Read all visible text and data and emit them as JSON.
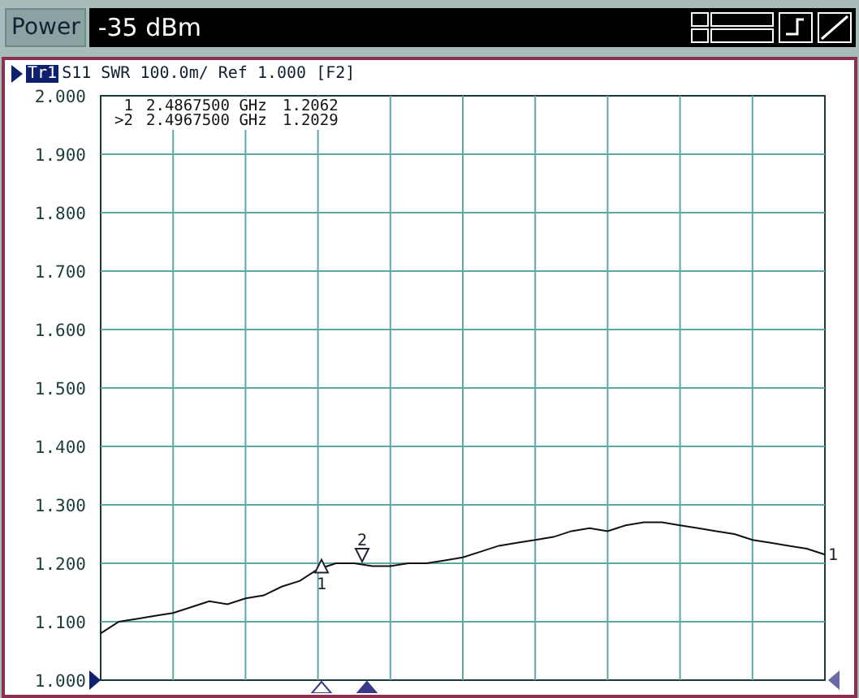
{
  "toolbar": {
    "label": "Power",
    "value": "-35 dBm"
  },
  "trace_header": {
    "trace": "Tr1",
    "text": "S11 SWR 100.0m/ Ref 1.000 [F2]"
  },
  "chart": {
    "chart_data": {
      "type": "line",
      "grid": true,
      "ylim": [
        1,
        2
      ],
      "yticks": [
        {
          "value": 2,
          "label": "2.000"
        },
        {
          "value": 1.9,
          "label": "1.900"
        },
        {
          "value": 1.8,
          "label": "1.800"
        },
        {
          "value": 1.7,
          "label": "1.700"
        },
        {
          "value": 1.6,
          "label": "1.600"
        },
        {
          "value": 1.5,
          "label": "1.500"
        },
        {
          "value": 1.4,
          "label": "1.400"
        },
        {
          "value": 1.3,
          "label": "1.300"
        },
        {
          "value": 1.2,
          "label": "1.200"
        },
        {
          "value": 1.1,
          "label": "1.100"
        },
        {
          "value": 1,
          "label": "1.000"
        }
      ],
      "series": [
        {
          "color": "#111111",
          "values": [
            1.08,
            1.1,
            1.105,
            1.11,
            1.115,
            1.125,
            1.135,
            1.13,
            1.14,
            1.145,
            1.16,
            1.17,
            1.19,
            1.2,
            1.2,
            1.195,
            1.195,
            1.2,
            1.2,
            1.205,
            1.21,
            1.22,
            1.23,
            1.235,
            1.24,
            1.245,
            1.255,
            1.26,
            1.255,
            1.265,
            1.27,
            1.27,
            1.265,
            1.26,
            1.255,
            1.25,
            1.24,
            1.235,
            1.23,
            1.225,
            1.215
          ]
        }
      ]
    }
  },
  "markers": [
    {
      "label": "1",
      "table_label": "1",
      "frequency": "2.4867500 GHz",
      "value": "1.2062",
      "selected": false
    },
    {
      "label": "2",
      "table_label": ">2",
      "frequency": "2.4967500 GHz",
      "value": "1.2029",
      "selected": true
    }
  ],
  "trace_end_label": "1"
}
